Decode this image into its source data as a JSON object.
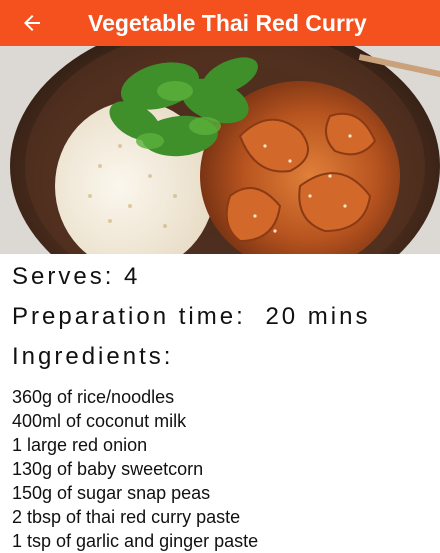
{
  "app_bar": {
    "title": "Vegetable Thai Red Curry",
    "background_color": "#f4511e",
    "back_icon": "arrow-back-icon"
  },
  "hero_image": {
    "subject": "bowl-of-thai-red-curry-with-rice-and-coriander"
  },
  "recipe": {
    "serves_label": "Serves:",
    "serves_value": "4",
    "prep_label": "Preparation time:",
    "prep_value": "20 mins",
    "ingredients_heading": "Ingredients:",
    "ingredients": [
      "360g of rice/noodles",
      "400ml of coconut milk",
      "1 large red onion",
      "130g of baby sweetcorn",
      "150g of sugar snap peas",
      "2 tbsp of thai red curry paste",
      "1 tsp of garlic and ginger paste"
    ]
  }
}
